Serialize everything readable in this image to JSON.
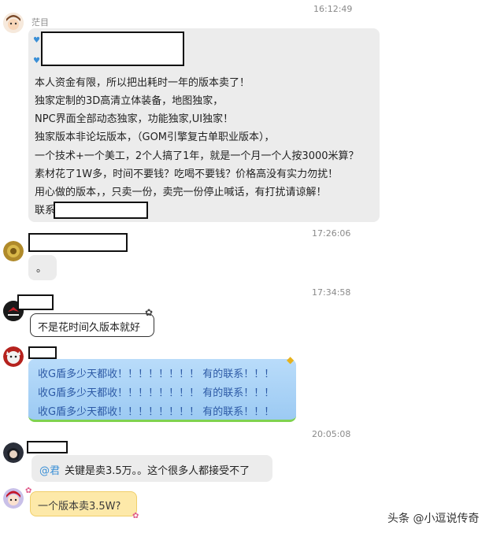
{
  "timestamps": [
    "16:12:49",
    "17:26:06",
    "17:34:58",
    "20:05:08"
  ],
  "messages": [
    {
      "sender": "茫目",
      "lines": [
        "本人资金有限，所以把出耗时一年的版本卖了！",
        "独家定制的3D高清立体装备，地图独家，",
        "NPC界面全部动态独家，功能独家,UI独家！",
        "独家版本非论坛版本，（GOM引擎复古单职业版本），",
        "一个技术+一个美工，2个人搞了1年，就是一个月一个人按3000米算？",
        "素材花了1W多，时间不要钱？吃喝不要钱？价格高没有实力勿扰！",
        "用心做的版本，，只卖一份，卖完一份停止喊话，有打扰请谅解！"
      ],
      "contact_label": "联系"
    },
    {
      "text": "。"
    },
    {
      "text": "不是花时间久版本就好"
    },
    {
      "lines": [
        "收G盾多少天都收！！！！！！！！ 有的联系！！！",
        "收G盾多少天都收！！！！！！！！ 有的联系！！！",
        "收G盾多少天都收！！！！！！！！ 有的联系！！！"
      ]
    },
    {
      "mention": "@君",
      "text": "关键是卖3.5万。。这个很多人都接受不了"
    },
    {
      "text": "一个版本卖3.5W?"
    }
  ],
  "watermark": "头条 @小逗说传奇",
  "colors": {
    "grey_bubble": "#ececec",
    "blue_bubble": "#a9d2f7",
    "yellow_bubble": "#fde9a9",
    "mention": "#3a8fd6"
  }
}
